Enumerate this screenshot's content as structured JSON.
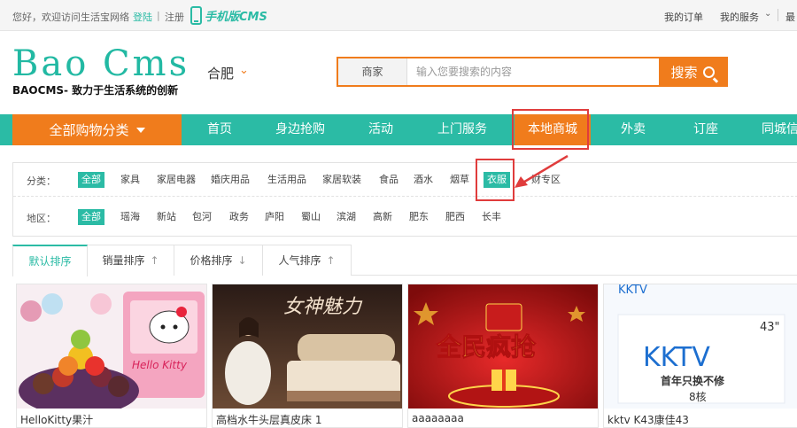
{
  "topbar": {
    "welcome": "您好，欢迎访问生活宝网络",
    "login": "登陆",
    "separator": "|",
    "register": "注册",
    "mobile_cms": "手机版CMS",
    "my_orders": "我的订单",
    "my_services": "我的服务",
    "more": "最"
  },
  "header": {
    "logo": "Bao Cms",
    "slogan": "BAOCMS- 致力于生活系统的创新",
    "city": "合肥"
  },
  "search": {
    "category": "商家",
    "placeholder": "输入您要搜索的内容",
    "button": "搜索"
  },
  "nav": {
    "all_categories": "全部购物分类",
    "items": [
      "首页",
      "身边抢购",
      "活动",
      "上门服务",
      "本地商城",
      "外卖",
      "订座",
      "同城信"
    ],
    "active_index": 4
  },
  "filters": {
    "category_label": "分类：",
    "categories": [
      "全部",
      "家具",
      "家居电器",
      "婚庆用品",
      "生活用品",
      "家居软装",
      "食品",
      "酒水",
      "烟草",
      "衣服",
      "财专区"
    ],
    "category_selected": "衣服",
    "region_label": "地区：",
    "regions": [
      "全部",
      "瑶海",
      "新站",
      "包河",
      "政务",
      "庐阳",
      "蜀山",
      "滨湖",
      "高新",
      "肥东",
      "肥西",
      "长丰"
    ],
    "region_selected": "全部"
  },
  "sort": {
    "tabs": [
      "默认排序",
      "销量排序",
      "价格排序",
      "人气排序"
    ],
    "arrows": [
      "",
      "↑",
      "↓",
      "↑"
    ]
  },
  "products": [
    {
      "title": "HelloKitty果汁",
      "image_text": "Hello Kitty"
    },
    {
      "title": "高档水牛头层真皮床 1",
      "image_text": "女神魅力"
    },
    {
      "title": "aaaaaaaa",
      "image_text": "全民疯抢"
    },
    {
      "title": "kktv K43康佳43",
      "image_text": "KKTV",
      "image_sub": "首年只换不修",
      "image_badge": "43\"",
      "image_bottom": "8核"
    }
  ],
  "colors": {
    "teal": "#2bbba5",
    "orange": "#f07c1c",
    "annotation_red": "#e03c3c"
  }
}
